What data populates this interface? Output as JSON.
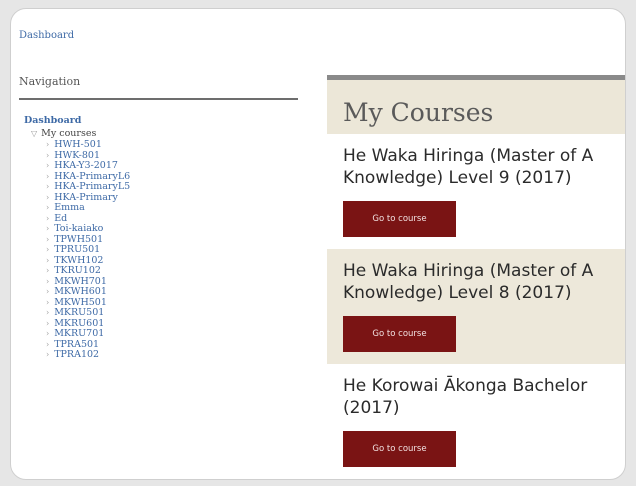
{
  "breadcrumb": "Dashboard",
  "navigation": {
    "heading": "Navigation",
    "root": "Dashboard",
    "my_courses": "My courses",
    "items": [
      "HWH-501",
      "HWK-801",
      "HKA-Y3-2017",
      "HKA-PrimaryL6",
      "HKA-PrimaryL5",
      "HKA-Primary",
      "Emma",
      "Ed",
      "Toi-kaiako",
      "TPWH501",
      "TPRU501",
      "TKWH102",
      "TKRU102",
      "MKWH701",
      "MKWH601",
      "MKWH501",
      "MKRU501",
      "MKRU601",
      "MKRU701",
      "TPRA501",
      "TPRA102"
    ]
  },
  "main": {
    "title": "My Courses",
    "courses": [
      {
        "line1": "He Waka Hiringa (Master of A",
        "line2": "Knowledge) Level 9 (2017)",
        "button": "Go to course"
      },
      {
        "line1": "He Waka Hiringa (Master of A",
        "line2": "Knowledge) Level 8 (2017)",
        "button": "Go to course"
      },
      {
        "line1": "He Korowai Ākonga Bachelor",
        "line2": "(2017)",
        "button": "Go to course"
      }
    ]
  },
  "colors": {
    "link": "#3e6aa6",
    "accent_band": "#ece7d8",
    "button": "#7a1414"
  }
}
